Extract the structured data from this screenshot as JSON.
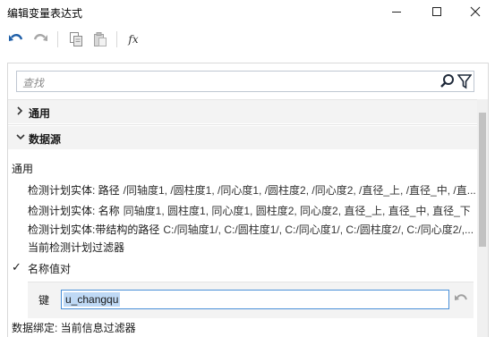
{
  "window": {
    "title": "编辑变量表达式"
  },
  "toolbar": {
    "fx_label": "fx"
  },
  "search": {
    "placeholder": "查找"
  },
  "sections": [
    {
      "label": "通用",
      "expanded": false
    },
    {
      "label": "数据源",
      "expanded": true
    }
  ],
  "group_label": "通用",
  "items": [
    {
      "key": "检测计划实体: 路径",
      "value": "/同轴度1, /圆柱度1, /同心度1, /圆柱度2, /同心度2, /直径_上, /直径_中, /直..."
    },
    {
      "key": "检测计划实体: 名称",
      "value": "同轴度1, 圆柱度1, 同心度1, 圆柱度2, 同心度2, 直径_上, 直径_中, 直径_下"
    },
    {
      "key": "检测计划实体:带结构的路径",
      "value": "C:/同轴度1/, C:/圆柱度1/, C:/同心度1/, C:/圆柱度2/, C:/同心度2/,..."
    }
  ],
  "filter_label": "当前检测计划过滤器",
  "name_value_pair": {
    "label": "名称值对",
    "checked": true,
    "key_label": "键",
    "key_value": "u_changqu"
  },
  "binding_label": "数据绑定: 当前信息过滤器"
}
